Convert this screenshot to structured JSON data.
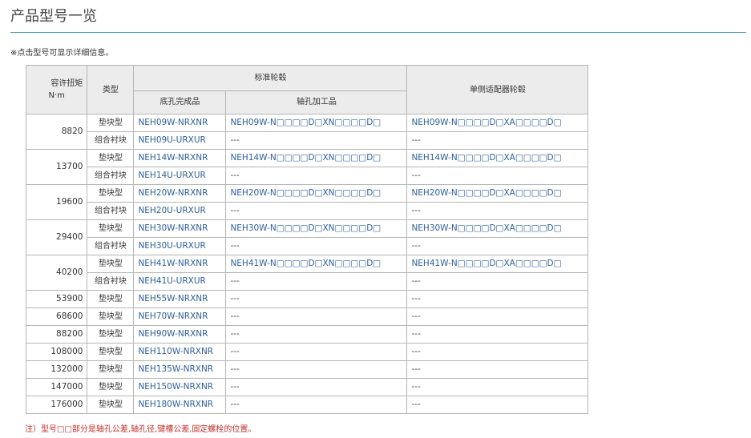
{
  "page": {
    "title": "产品型号一览",
    "notice": "※点击型号可显示详细信息。",
    "footnote": "注）型号□□部分是轴孔公差,轴孔径,键槽公差,固定螺栓的位置。"
  },
  "table": {
    "headers": {
      "torque": "容许扭矩\nN·m",
      "type": "类型",
      "standard_hub": "标准轮毂",
      "pilot_bore": "底孔完成品",
      "bore_machined": "轴孔加工品",
      "single_adapter_hub": "单侧适配器轮毂"
    },
    "rows": [
      {
        "torque": "8820",
        "type": "垫块型",
        "pilot": "NEH09W-NRXNR",
        "bored": "NEH09W-N□□□□D□XN□□□□D□",
        "adapter": "NEH09W-N□□□□D□XA□□□□D□"
      },
      {
        "torque": "",
        "type": "组合衬块",
        "pilot": "NEH09U-URXUR",
        "bored": "---",
        "adapter": "---"
      },
      {
        "torque": "13700",
        "type": "垫块型",
        "pilot": "NEH14W-NRXNR",
        "bored": "NEH14W-N□□□□D□XN□□□□D□",
        "adapter": "NEH14W-N□□□□D□XA□□□□D□"
      },
      {
        "torque": "",
        "type": "组合衬块",
        "pilot": "NEH14U-URXUR",
        "bored": "---",
        "adapter": "---"
      },
      {
        "torque": "19600",
        "type": "垫块型",
        "pilot": "NEH20W-NRXNR",
        "bored": "NEH20W-N□□□□D□XN□□□□D□",
        "adapter": "NEH20W-N□□□□D□XA□□□□D□"
      },
      {
        "torque": "",
        "type": "组合衬块",
        "pilot": "NEH20U-URXUR",
        "bored": "---",
        "adapter": "---"
      },
      {
        "torque": "29400",
        "type": "垫块型",
        "pilot": "NEH30W-NRXNR",
        "bored": "NEH30W-N□□□□D□XN□□□□D□",
        "adapter": "NEH30W-N□□□□D□XA□□□□D□"
      },
      {
        "torque": "",
        "type": "组合衬块",
        "pilot": "NEH30U-URXUR",
        "bored": "---",
        "adapter": "---"
      },
      {
        "torque": "40200",
        "type": "垫块型",
        "pilot": "NEH41W-NRXNR",
        "bored": "NEH41W-N□□□□D□XN□□□□D□",
        "adapter": "NEH41W-N□□□□D□XA□□□□D□"
      },
      {
        "torque": "",
        "type": "组合衬块",
        "pilot": "NEH41U-URXUR",
        "bored": "---",
        "adapter": "---"
      },
      {
        "torque": "53900",
        "type": "垫块型",
        "pilot": "NEH55W-NRXNR",
        "bored": "---",
        "adapter": "---"
      },
      {
        "torque": "68600",
        "type": "垫块型",
        "pilot": "NEH70W-NRXNR",
        "bored": "---",
        "adapter": "---"
      },
      {
        "torque": "88200",
        "type": "垫块型",
        "pilot": "NEH90W-NRXNR",
        "bored": "---",
        "adapter": "---"
      },
      {
        "torque": "108000",
        "type": "垫块型",
        "pilot": "NEH110W-NRXNR",
        "bored": "---",
        "adapter": "---"
      },
      {
        "torque": "132000",
        "type": "垫块型",
        "pilot": "NEH135W-NRXNR",
        "bored": "---",
        "adapter": "---"
      },
      {
        "torque": "147000",
        "type": "垫块型",
        "pilot": "NEH150W-NRXNR",
        "bored": "---",
        "adapter": "---"
      },
      {
        "torque": "176000",
        "type": "垫块型",
        "pilot": "NEH180W-NRXNR",
        "bored": "---",
        "adapter": "---"
      }
    ]
  },
  "colors": {
    "accent_rule": "#4aa3a8",
    "link": "#2d5f9a",
    "note_red": "#c0302a",
    "header_bg": "#ececec"
  }
}
